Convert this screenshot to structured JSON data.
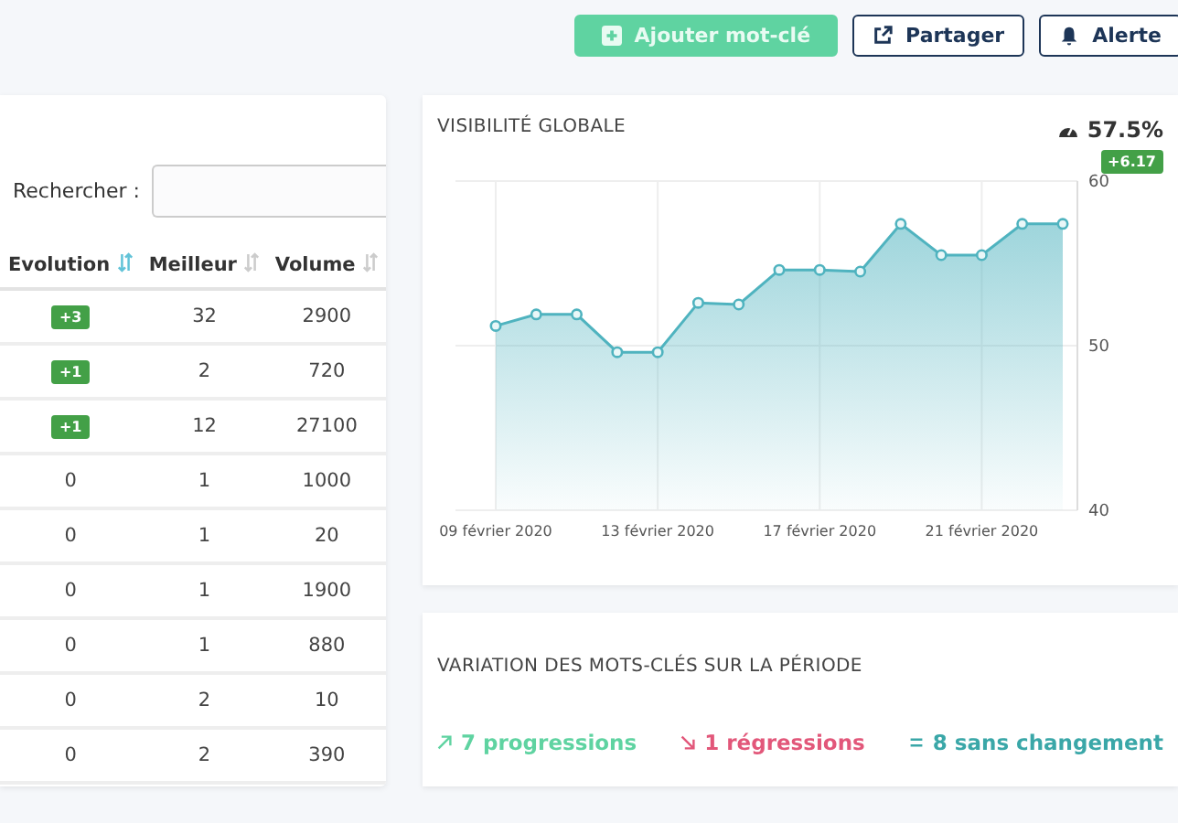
{
  "toolbar": {
    "buttons": [
      {
        "kind": "add",
        "label": "Ajouter mot-clé"
      },
      {
        "kind": "share",
        "label": "Partager"
      },
      {
        "kind": "alert",
        "label": "Alerte"
      }
    ]
  },
  "keywords_table": {
    "search": {
      "label": "Rechercher :"
    },
    "columns": [
      {
        "label": "Evolution",
        "sorted": true
      },
      {
        "label": "Meilleur",
        "sorted": false
      },
      {
        "label": "Volume",
        "sorted": false
      }
    ],
    "rows": [
      {
        "evolution": "+3",
        "kind": "badge",
        "best": "32",
        "volume": "2900"
      },
      {
        "evolution": "+1",
        "kind": "badge",
        "best": "2",
        "volume": "720"
      },
      {
        "evolution": "+1",
        "kind": "badge",
        "best": "12",
        "volume": "27100"
      },
      {
        "evolution": "0",
        "kind": "plain",
        "best": "1",
        "volume": "1000"
      },
      {
        "evolution": "0",
        "kind": "plain",
        "best": "1",
        "volume": "20"
      },
      {
        "evolution": "0",
        "kind": "plain",
        "best": "1",
        "volume": "1900"
      },
      {
        "evolution": "0",
        "kind": "plain",
        "best": "1",
        "volume": "880"
      },
      {
        "evolution": "0",
        "kind": "plain",
        "best": "2",
        "volume": "10"
      },
      {
        "evolution": "0",
        "kind": "plain",
        "best": "2",
        "volume": "390"
      }
    ]
  },
  "visibility": {
    "title": "VISIBILITÉ GLOBALE",
    "value": "57.5%",
    "change": "+6.17",
    "chart_data": {
      "type": "area",
      "grid": true,
      "categories": [
        "09 février 2020",
        null,
        null,
        null,
        "13 février 2020",
        null,
        null,
        null,
        "17 février 2020",
        null,
        null,
        null,
        "21 février 2020",
        null,
        null
      ],
      "series": [
        {
          "color": "#4fb3bf",
          "values": [
            51.2,
            51.9,
            51.9,
            49.6,
            49.6,
            52.6,
            52.5,
            54.6,
            54.6,
            54.5,
            57.4,
            55.5,
            55.5,
            57.4,
            57.4
          ]
        }
      ],
      "ylim": [
        40,
        60
      ],
      "yticks": [
        40,
        50,
        60
      ]
    }
  },
  "variation": {
    "title": "VARIATION DES MOTS-CLÉS SUR LA PÉRIODE",
    "stats": [
      {
        "kind": "up",
        "label": "7 progressions",
        "color": "#5fd3a1"
      },
      {
        "kind": "down",
        "label": "1 régressions",
        "color": "#e2577a"
      },
      {
        "kind": "same",
        "label": "8 sans changement",
        "color": "#3aa7a8"
      }
    ]
  }
}
